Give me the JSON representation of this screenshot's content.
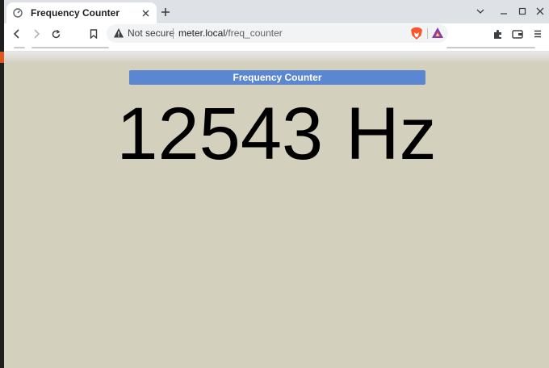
{
  "browser": {
    "tab": {
      "title": "Frequency Counter"
    },
    "address_bar": {
      "security_label": "Not secure",
      "url_host": "meter.local",
      "url_path": "/freq_counter"
    }
  },
  "page": {
    "header": "Frequency Counter",
    "reading": {
      "value": "12543",
      "unit": "Hz"
    }
  },
  "colors": {
    "page_background": "#d3d0be",
    "header_background": "#5b86d1",
    "reading_text": "#000000"
  },
  "icons": [
    "meter-favicon-icon",
    "close-icon",
    "plus-icon",
    "chevron-down-icon",
    "minimize-icon",
    "maximize-icon",
    "window-close-icon",
    "back-arrow-icon",
    "forward-arrow-icon",
    "reload-icon",
    "bookmark-icon",
    "warning-icon",
    "brave-shield-icon",
    "brave-rewards-icon",
    "extensions-icon",
    "wallet-icon",
    "menu-icon"
  ]
}
